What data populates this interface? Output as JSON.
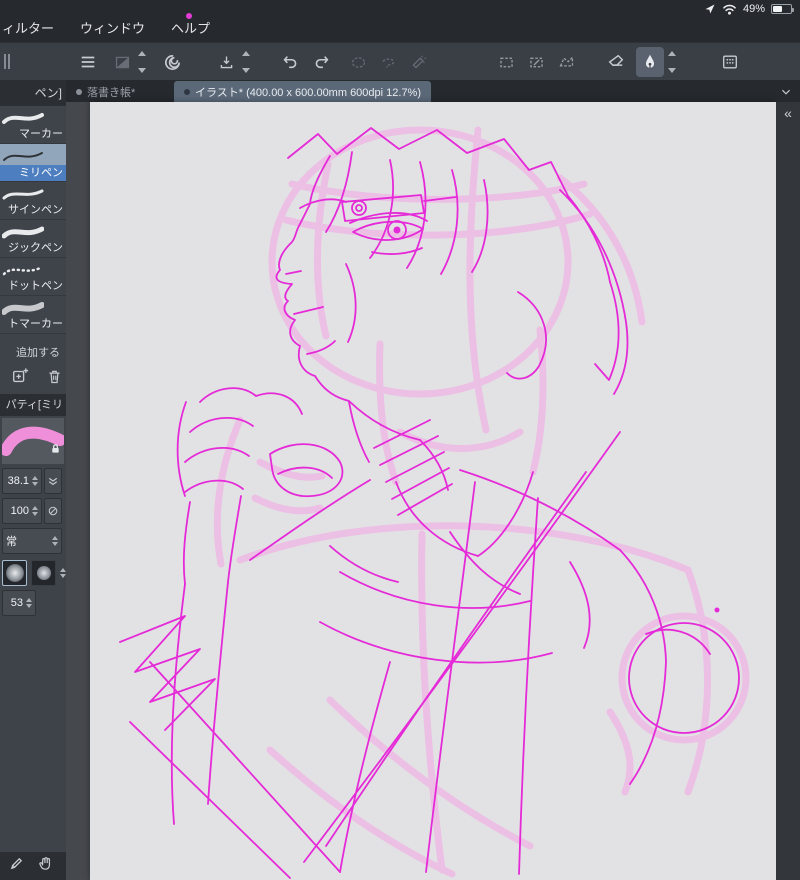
{
  "status_bar": {
    "battery_percent": "49%",
    "icons": [
      "location-arrow-icon",
      "wifi-icon",
      "battery-icon"
    ]
  },
  "menu_bar": {
    "items": [
      {
        "label": "ィルター"
      },
      {
        "label": "ウィンドウ"
      },
      {
        "label": "ヘルプ"
      }
    ]
  },
  "toolbar": {
    "icons": [
      "menu-icon",
      "gradient-tool-icon",
      "csp-logo-icon",
      "import-icon",
      "undo-icon",
      "redo-icon",
      "select-ellipse-icon",
      "select-lasso-icon",
      "select-wand-icon",
      "marquee-rect-icon",
      "marquee-new-icon",
      "marquee-poly-icon",
      "eraser-icon",
      "pen-icon",
      "tablet-icon"
    ]
  },
  "tab_bar": {
    "tabs": [
      {
        "label": "落書き帳*",
        "active": false
      },
      {
        "label": "イラスト* (400.00 x 600.00mm 600dpi 12.7%)",
        "active": true
      }
    ]
  },
  "subtool_panel": {
    "header": "ペン]",
    "tools": [
      {
        "label": "マーカー",
        "selected": false
      },
      {
        "label": "ミリペン",
        "selected": true
      },
      {
        "label": "サインペン",
        "selected": false
      },
      {
        "label": "ジックペン",
        "selected": false
      },
      {
        "label": "ドットペン",
        "selected": false
      },
      {
        "label": "トマーカー",
        "selected": false
      }
    ],
    "add_label": "追加する",
    "property_header": "パティ[ミリペ",
    "brush_size": "38.1",
    "opacity": "100",
    "blend_mode": "常",
    "stabilization": "53"
  },
  "panel_toggle": {
    "collapse_left": "«"
  },
  "colors": {
    "accent_blue": "#4d7ec0",
    "tab_active": "#5a6878",
    "sketch_magenta": "#e52ad8",
    "sketch_pink": "#f3abe6",
    "canvas_paper": "#e2e2e4",
    "panel_bg": "#3e4349",
    "notification_dot": "#e23bd6"
  }
}
